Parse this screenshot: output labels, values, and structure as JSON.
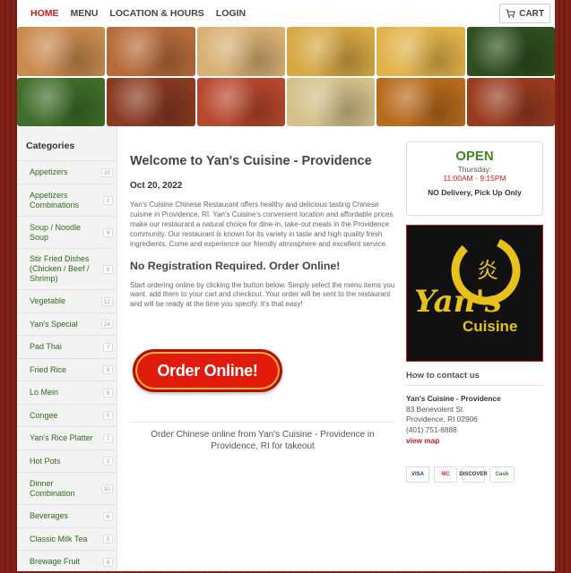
{
  "nav": {
    "links": [
      {
        "label": "HOME",
        "active": true
      },
      {
        "label": "MENU"
      },
      {
        "label": "LOCATION & HOURS"
      },
      {
        "label": "LOGIN"
      }
    ],
    "cart_label": "CART"
  },
  "banner_colors": [
    "#c98a4e",
    "#b86b3a",
    "#d9b074",
    "#d7a844",
    "#e2b34a",
    "#2e4f1f",
    "#3f6d2a",
    "#8a3a22",
    "#b7472d",
    "#d4c08a",
    "#b86b1c",
    "#9a3b1f"
  ],
  "sidebar": {
    "heading": "Categories",
    "items": [
      {
        "label": "Appetizers",
        "count": "20",
        "h": 26
      },
      {
        "label": "Appetizers Combinations",
        "count": "2",
        "h": 36
      },
      {
        "label": "Soup / Noodle Soup",
        "count": "9",
        "h": 36
      },
      {
        "label": "Stir Fried Dishes (Chicken / Beef / Shrimp)",
        "count": "8",
        "h": 46
      },
      {
        "label": "Vegetable",
        "count": "12",
        "h": 26
      },
      {
        "label": "Yan's Special",
        "count": "24",
        "h": 25
      },
      {
        "label": "Pad Thai",
        "count": "7",
        "h": 26
      },
      {
        "label": "Fried Rice",
        "count": "9",
        "h": 25
      },
      {
        "label": "Lo Mein",
        "count": "9",
        "h": 26
      },
      {
        "label": "Congee",
        "count": "5",
        "h": 25
      },
      {
        "label": "Yan's Rice Platter",
        "count": "7",
        "h": 26
      },
      {
        "label": "Hot Pots",
        "count": "2",
        "h": 25
      },
      {
        "label": "Dinner Combination",
        "count": "32",
        "h": 36
      },
      {
        "label": "Beverages",
        "count": "6",
        "h": 26
      },
      {
        "label": "Classic Milk Tea",
        "count": "5",
        "h": 25
      },
      {
        "label": "Brewage Fruit",
        "count": "8",
        "h": 26
      }
    ]
  },
  "main": {
    "title": "Welcome to Yan's Cuisine - Providence",
    "date": "Oct 20, 2022",
    "intro": "Yan's Cuisine Chinese Restaurant offers healthy and delicious tasting Chinese cuisine in Providence, RI. Yan's Cuisine's convenient location and affordable prices make our restaurant a natural choice for dine-in, take-out meals in the Providence community. Our restaurant is known for its variety in taste and high quality fresh ingredients. Come and experience our friendly atmosphere and excellent service.",
    "subtitle": "No Registration Required. Order Online!",
    "steps": "Start ordering online by clicking the button below. Simply select the menu items you want, add them to your cart and checkout. Your order will be sent to the restaurant and will be ready at the time you specify. It's that easy!",
    "order_button": "Order Online!",
    "footnote": "Order Chinese online from Yan's Cuisine - Providence in Providence, RI for takeout"
  },
  "hours": {
    "status": "OPEN",
    "day": "Thursday:",
    "time": "11:00AM - 9:15PM",
    "delivery": "NO Delivery, Pick Up Only"
  },
  "logo": {
    "line1": "Yan's",
    "line2": "Cuisine",
    "seal": "炎"
  },
  "contact": {
    "title": "How to contact us",
    "name": "Yan's Cuisine - Providence",
    "street": "83 Benevolent St",
    "city": "Providence, RI 02906",
    "phone": "(401) 751-8888",
    "map_link": "view map"
  },
  "payments": [
    {
      "label": "VISA",
      "color": "#1a3a8c",
      "w": 26
    },
    {
      "label": "MC",
      "color": "#e8231a",
      "w": 26
    },
    {
      "label": "DISCOVER",
      "color": "#333333",
      "w": 26
    },
    {
      "label": "Cash",
      "color": "#3a7a2a",
      "w": 28
    }
  ]
}
